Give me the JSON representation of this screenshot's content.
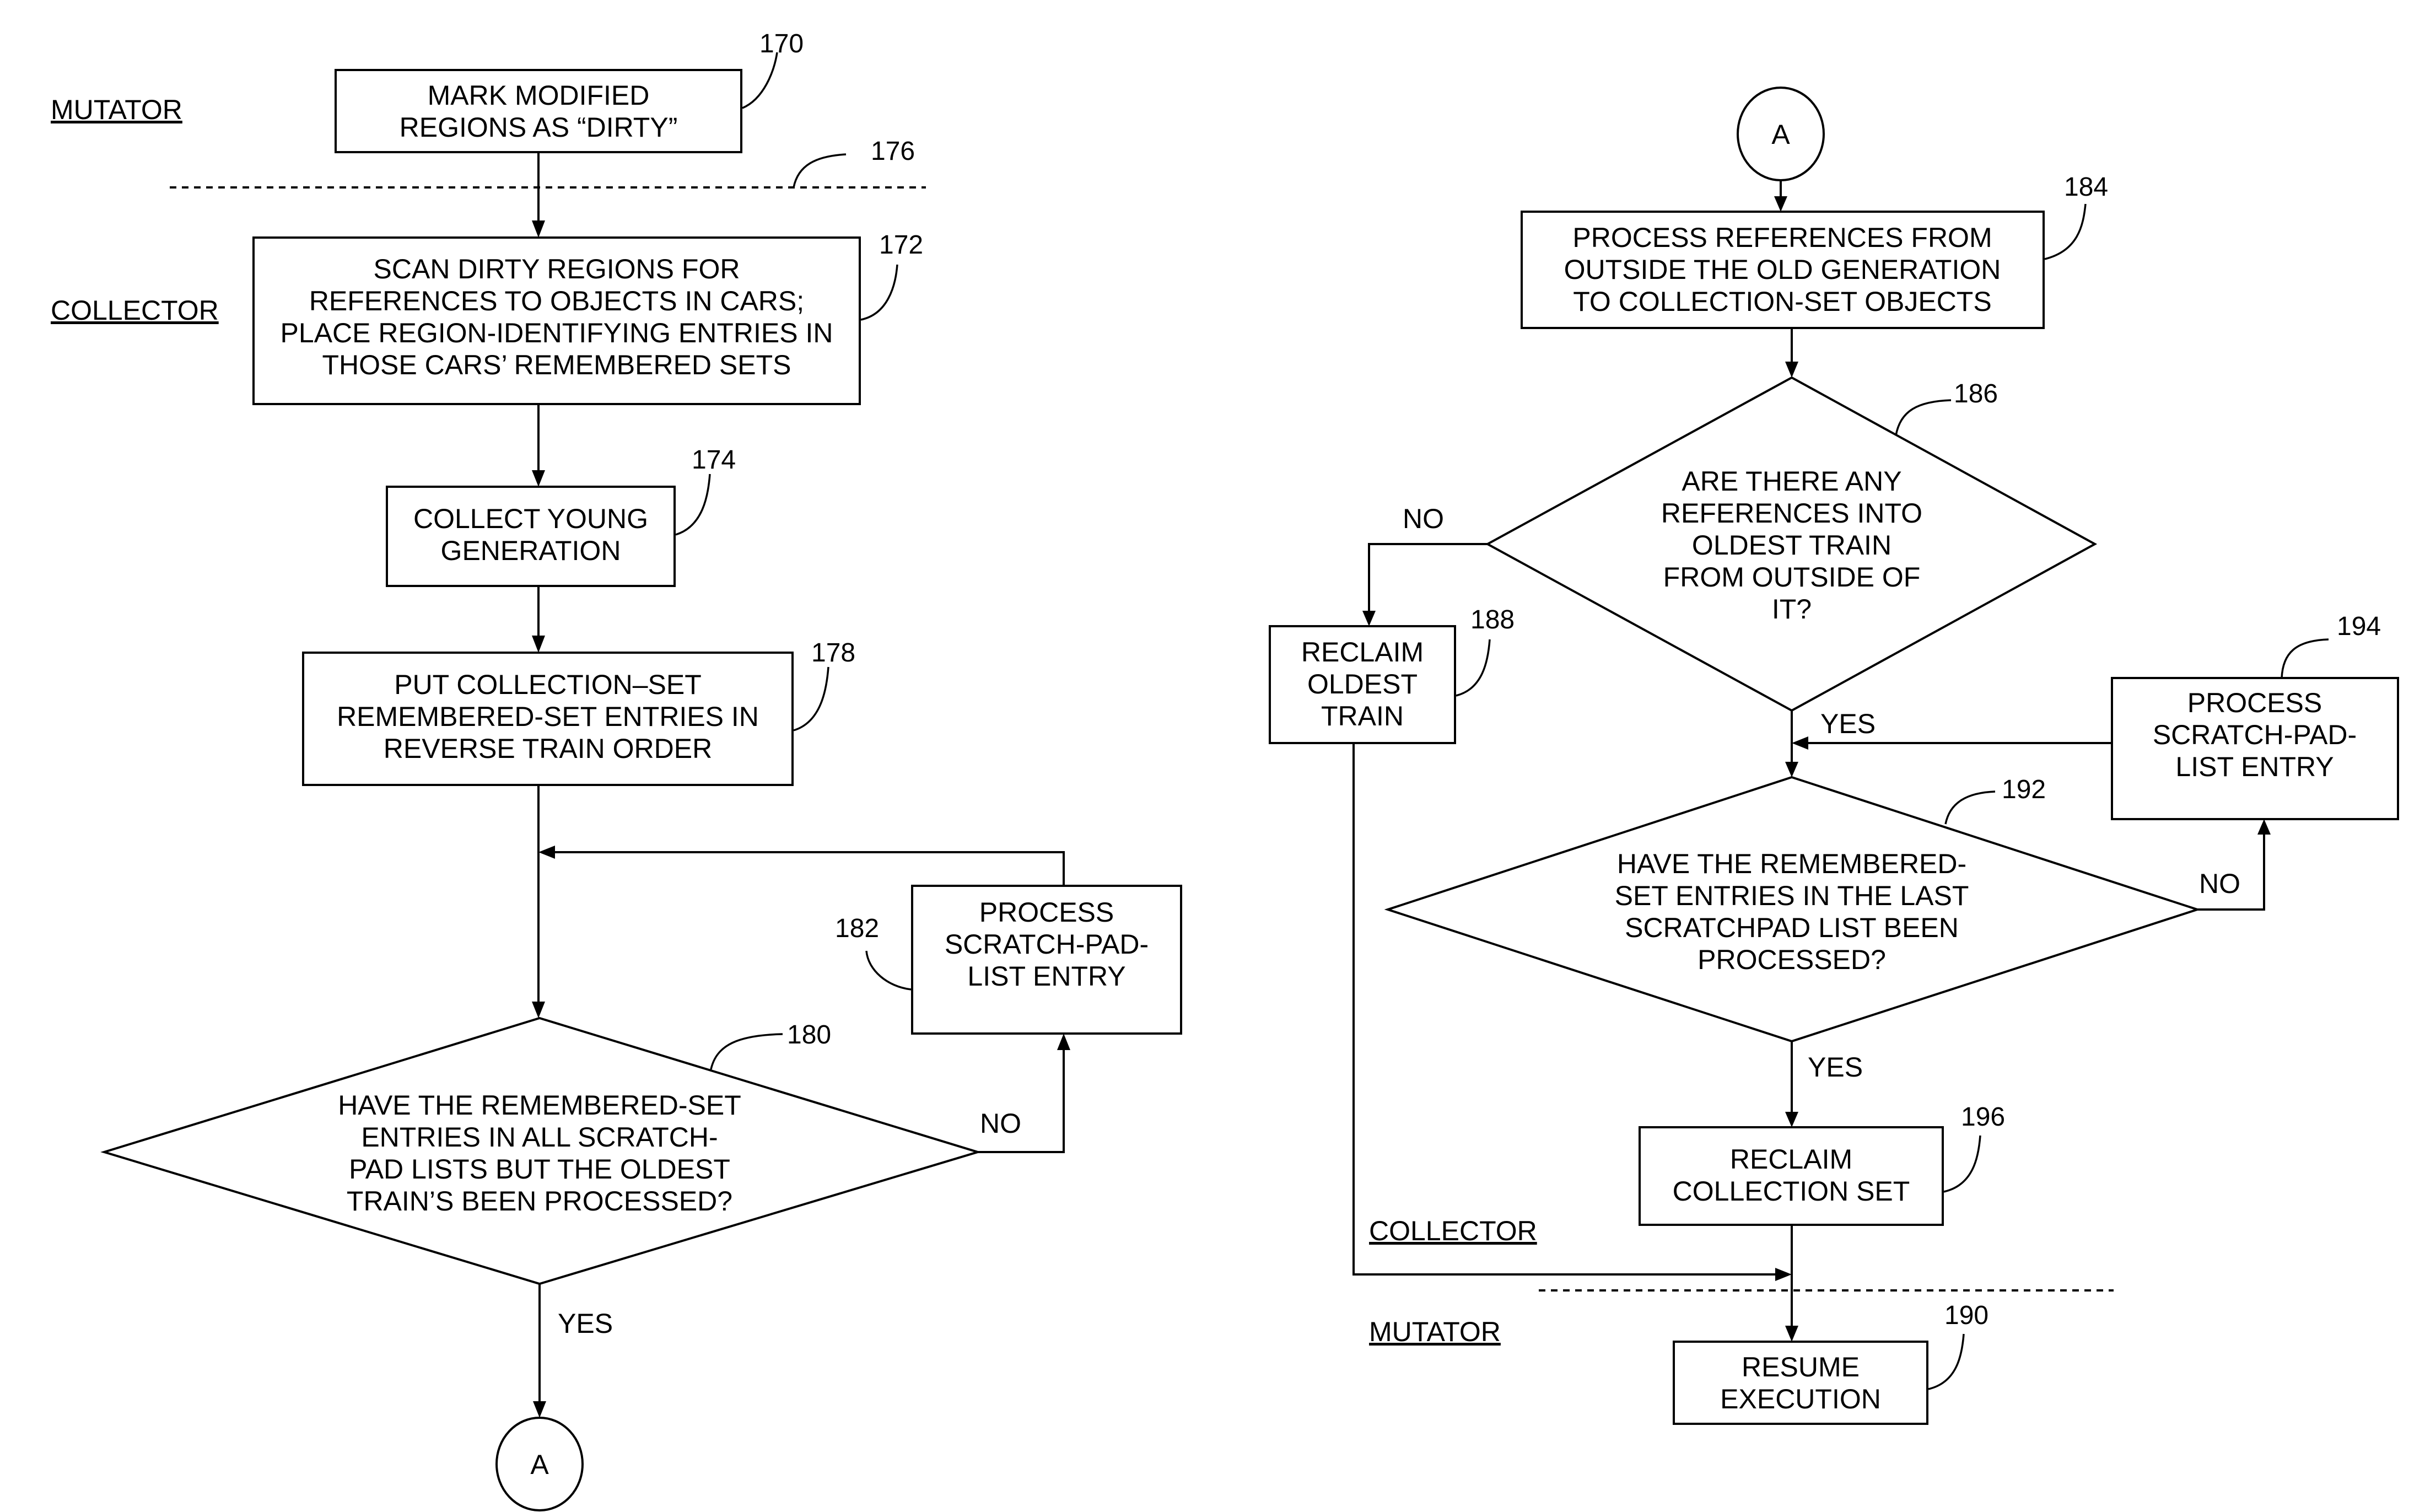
{
  "lanes": {
    "left_mutator": "MUTATOR",
    "left_collector": "COLLECTOR",
    "right_collector": "COLLECTOR",
    "right_mutator": "MUTATOR"
  },
  "steps": {
    "s170": {
      "ref": "170",
      "lines": [
        "MARK MODIFIED",
        "REGIONS AS “DIRTY”"
      ]
    },
    "s176": {
      "ref": "176"
    },
    "s172": {
      "ref": "172",
      "lines": [
        "SCAN DIRTY REGIONS FOR",
        "REFERENCES TO OBJECTS IN CARS;",
        "PLACE REGION-IDENTIFYING ENTRIES IN",
        "THOSE CARS’ REMEMBERED SETS"
      ]
    },
    "s174": {
      "ref": "174",
      "lines": [
        "COLLECT YOUNG",
        "GENERATION"
      ]
    },
    "s178": {
      "ref": "178",
      "lines": [
        "PUT COLLECTION–SET",
        "REMEMBERED-SET ENTRIES IN",
        "REVERSE TRAIN ORDER"
      ]
    },
    "s180": {
      "ref": "180",
      "lines": [
        "HAVE THE REMEMBERED-SET",
        "ENTRIES IN ALL SCRATCH-",
        "PAD LISTS BUT THE OLDEST",
        "TRAIN’S BEEN PROCESSED?"
      ]
    },
    "s182": {
      "ref": "182",
      "lines": [
        "PROCESS",
        "SCRATCH-PAD-",
        "LIST ENTRY"
      ]
    },
    "s184": {
      "ref": "184",
      "lines": [
        "PROCESS REFERENCES FROM",
        "OUTSIDE THE OLD GENERATION",
        "TO COLLECTION-SET OBJECTS"
      ]
    },
    "s186": {
      "ref": "186",
      "lines": [
        "ARE THERE ANY",
        "REFERENCES INTO",
        "OLDEST TRAIN",
        "FROM OUTSIDE OF",
        "IT?"
      ]
    },
    "s188": {
      "ref": "188",
      "lines": [
        "RECLAIM",
        "OLDEST",
        "TRAIN"
      ]
    },
    "s192": {
      "ref": "192",
      "lines": [
        "HAVE THE REMEMBERED-",
        "SET ENTRIES IN THE LAST",
        "SCRATCHPAD LIST BEEN",
        "PROCESSED?"
      ]
    },
    "s194": {
      "ref": "194",
      "lines": [
        "PROCESS",
        "SCRATCH-PAD-",
        "LIST ENTRY"
      ]
    },
    "s196": {
      "ref": "196",
      "lines": [
        "RECLAIM",
        "COLLECTION SET"
      ]
    },
    "s190": {
      "ref": "190",
      "lines": [
        "RESUME",
        "EXECUTION"
      ]
    }
  },
  "connectors": {
    "left_out": "A",
    "right_in": "A"
  },
  "branch_labels": {
    "b180_no": "NO",
    "b180_yes": "YES",
    "b186_no": "NO",
    "b186_yes": "YES",
    "b192_no": "NO",
    "b192_yes": "YES"
  }
}
